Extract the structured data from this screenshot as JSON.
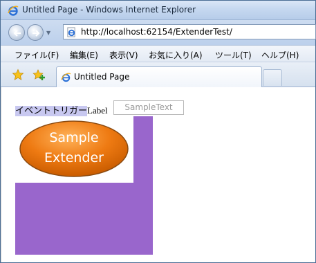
{
  "window": {
    "title": "Untitled Page - Windows Internet Explorer"
  },
  "address_bar": {
    "url": "http://localhost:62154/ExtenderTest/"
  },
  "menu": {
    "items": [
      "ファイル(F)",
      "編集(E)",
      "表示(V)",
      "お気に入り(A)",
      "ツール(T)",
      "ヘルプ(H)"
    ]
  },
  "tab": {
    "label": "Untitled Page"
  },
  "page": {
    "trigger_text": "イベントトリガー",
    "label_text": "Label",
    "input_placeholder": "SampleText",
    "extender_line1": "Sample",
    "extender_line2": "Extender"
  },
  "colors": {
    "purple_panel": "#9966cc",
    "extender_orange": "#ee7a12",
    "trigger_highlight": "#c8c8f0"
  },
  "icons": {
    "title": "ie-logo-icon",
    "back": "back-arrow-icon",
    "forward": "forward-arrow-icon",
    "favorites": "star-icon",
    "add_favorites": "add-favorite-icon"
  }
}
